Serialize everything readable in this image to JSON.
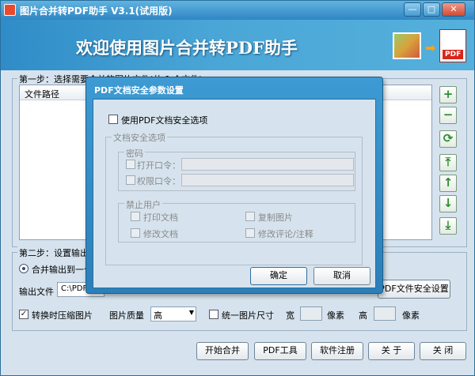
{
  "window": {
    "title": "图片合并转PDF助手 V3.1(试用版)",
    "min": "—",
    "max": "□",
    "close": "✕"
  },
  "banner": {
    "text": "欢迎使用图片合并转PDF助手",
    "pdf_badge": "PDF",
    "arrow": "➡"
  },
  "step1": {
    "label": "第一步：选择需要合并的图片文件(共 0 个文件)",
    "column_header": "文件路径"
  },
  "side_buttons": [
    {
      "icon": "plus-icon",
      "glyph": "+"
    },
    {
      "icon": "minus-icon",
      "glyph": "−"
    },
    {
      "icon": "refresh-icon",
      "glyph": "⟳"
    },
    {
      "icon": "move-top-icon",
      "glyph": "⤒"
    },
    {
      "icon": "move-up-icon",
      "glyph": "↑"
    },
    {
      "icon": "move-down-icon",
      "glyph": "↓"
    },
    {
      "icon": "move-bottom-icon",
      "glyph": "⤓"
    }
  ],
  "step2": {
    "label": "第二步：设置输出参",
    "radio_merge": "合并输出到一个",
    "output_label": "输出文件",
    "output_value": "C:\\PDFO",
    "security_button": "PDF文件安全设置",
    "compress_label": "转换时压缩图片",
    "quality_label": "图片质量",
    "quality_value": "高",
    "unify_label": "统一图片尺寸",
    "width_label": "宽",
    "width_unit": "像素",
    "height_label": "高",
    "height_unit": "像素"
  },
  "bottom_buttons": {
    "start": "开始合并",
    "pdf_tool": "PDF工具",
    "register": "软件注册",
    "about": "关  于",
    "close": "关  闭"
  },
  "dialog": {
    "title": "PDF文档安全参数设置",
    "use_security": "使用PDF文档安全选项",
    "options_group": "文档安全选项",
    "password_group": "密码",
    "open_password": "打开口令：",
    "permission_password": "权限口令：",
    "forbid_group": "禁止用户",
    "print_doc": "打印文档",
    "copy_image": "复制图片",
    "modify_doc": "修改文档",
    "modify_comment": "修改评论/注释",
    "ok": "确定",
    "cancel": "取消"
  }
}
